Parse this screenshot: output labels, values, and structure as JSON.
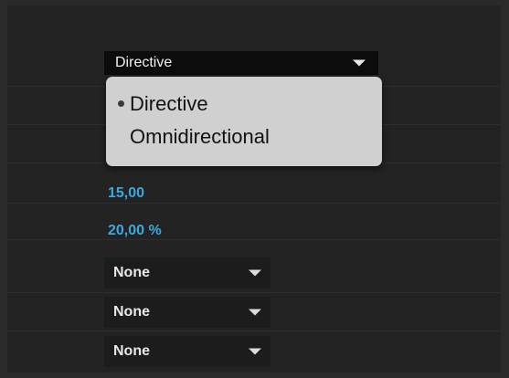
{
  "properties": {
    "mode_dropdown": {
      "selected": "Directive"
    },
    "popup_options": [
      {
        "label": "Directive",
        "checked": true
      },
      {
        "label": "Omnidirectional",
        "checked": false
      }
    ],
    "value_1": "15,00",
    "value_2": "20,00 %",
    "none_dropdowns": [
      {
        "selected": "None"
      },
      {
        "selected": "None"
      },
      {
        "selected": "None"
      }
    ]
  },
  "colors": {
    "value_text": "#3aa9df",
    "popup_bg": "#d0d0d0",
    "panel_bg": "#232323"
  }
}
